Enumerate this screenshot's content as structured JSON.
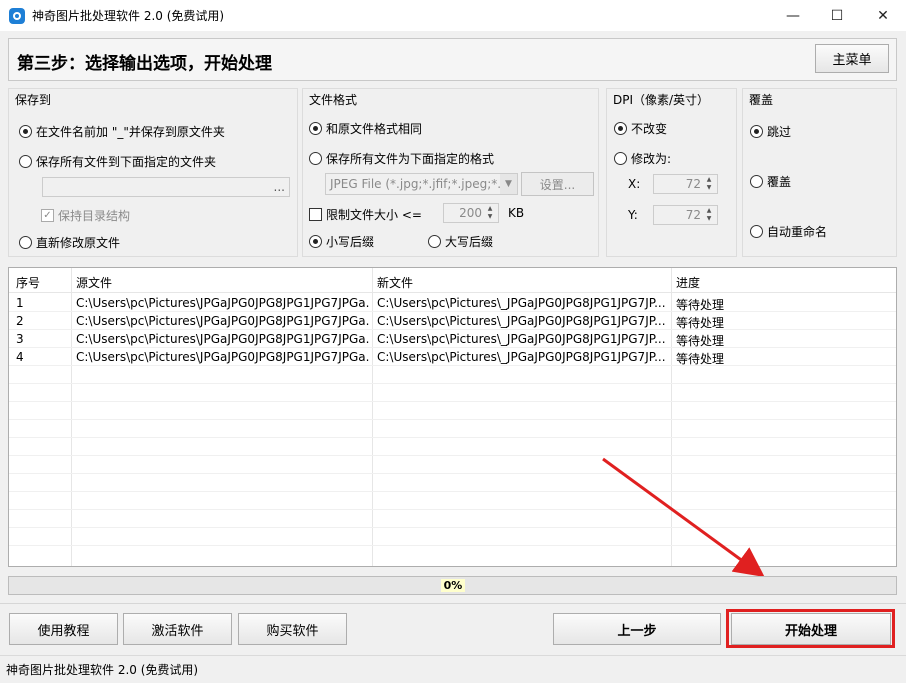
{
  "window": {
    "title": "神奇图片批处理软件 2.0 (免费试用)",
    "minimize": "—",
    "maximize": "☐",
    "close": "✕"
  },
  "header": {
    "step_title": "第三步：选择输出选项，开始处理",
    "main_menu_label": "主菜单"
  },
  "save_to": {
    "title": "保存到",
    "option_prefix": "在文件名前加 \"_\"并保存到原文件夹",
    "option_folder": "保存所有文件到下面指定的文件夹",
    "folder_path_value": "",
    "browse_label": "...",
    "keep_structure_label": "保持目录结构",
    "option_overwrite": "直新修改原文件"
  },
  "file_format": {
    "title": "文件格式",
    "option_same": "和原文件格式相同",
    "option_specified": "保存所有文件为下面指定的格式",
    "format_selected": "JPEG File (*.jpg;*.jfif;*.jpeg;*.j",
    "settings_label": "设置...",
    "limit_size_label": "限制文件大小 <=",
    "limit_size_value": "200",
    "limit_size_unit": "KB",
    "lowercase_ext": "小写后缀",
    "uppercase_ext": "大写后缀"
  },
  "dpi": {
    "title": "DPI（像素/英寸）",
    "option_keep": "不改变",
    "option_change": "修改为:",
    "x_label": "X:",
    "x_value": "72",
    "y_label": "Y:",
    "y_value": "72"
  },
  "overwrite": {
    "title": "覆盖",
    "option_skip": "跳过",
    "option_overwrite": "覆盖",
    "option_rename": "自动重命名"
  },
  "table": {
    "columns": [
      "序号",
      "源文件",
      "新文件",
      "进度"
    ],
    "rows": [
      [
        "1",
        "C:\\Users\\pc\\Pictures\\JPGaJPG0JPG8JPG1JPG7JPGa...",
        "C:\\Users\\pc\\Pictures\\_JPGaJPG0JPG8JPG1JPG7JP...",
        "等待处理"
      ],
      [
        "2",
        "C:\\Users\\pc\\Pictures\\JPGaJPG0JPG8JPG1JPG7JPGa...",
        "C:\\Users\\pc\\Pictures\\_JPGaJPG0JPG8JPG1JPG7JP...",
        "等待处理"
      ],
      [
        "3",
        "C:\\Users\\pc\\Pictures\\JPGaJPG0JPG8JPG1JPG7JPGa...",
        "C:\\Users\\pc\\Pictures\\_JPGaJPG0JPG8JPG1JPG7JP...",
        "等待处理"
      ],
      [
        "4",
        "C:\\Users\\pc\\Pictures\\JPGaJPG0JPG8JPG1JPG7JPGa...",
        "C:\\Users\\pc\\Pictures\\_JPGaJPG0JPG8JPG1JPG7JP...",
        "等待处理"
      ]
    ]
  },
  "progress": {
    "text": "0%",
    "value": 0
  },
  "buttons": {
    "tutorial": "使用教程",
    "activate": "激活软件",
    "buy": "购买软件",
    "prev": "上一步",
    "start": "开始处理"
  },
  "status_bar": {
    "text": "神奇图片批处理软件 2.0 (免费试用)"
  },
  "colors": {
    "highlight": "#e02020",
    "progress_bg": "#e6e6e6",
    "accent_icon": "#1e7fd6"
  }
}
